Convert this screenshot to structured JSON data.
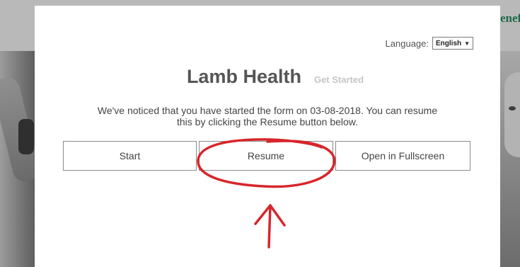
{
  "background": {
    "brand_text": "enef"
  },
  "modal": {
    "language": {
      "label": "Language:",
      "selected": "English",
      "caret": "▼"
    },
    "title": "Lamb Health",
    "subtitle": "Get Started",
    "notice_line1": "We've noticed that you have started the form on 03-08-2018. You can resume",
    "notice_line2": "this by clicking the Resume button below.",
    "buttons": {
      "start": "Start",
      "resume": "Resume",
      "fullscreen": "Open in Fullscreen"
    }
  },
  "annotation": {
    "color": "#d7262b",
    "shapes": [
      "circle-around-resume",
      "up-arrow-pointing-to-resume"
    ]
  }
}
